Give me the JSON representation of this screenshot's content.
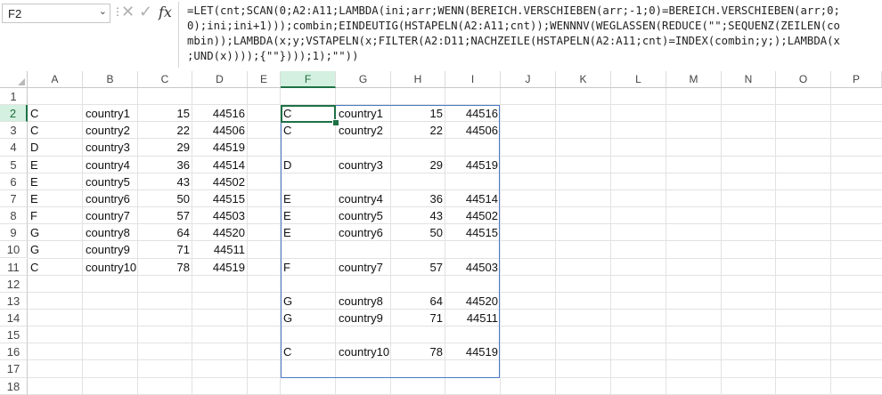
{
  "formula_bar": {
    "name_box": "F2",
    "fx_label": "fx",
    "formula_lines": [
      "=LET(cnt;SCAN(0;A2:A11;LAMBDA(ini;arr;WENN(BEREICH.VERSCHIEBEN(arr;-1;0)=BEREICH.VERSCHIEBEN(arr;0;",
      "0);ini;ini+1)));combin;EINDEUTIG(HSTAPELN(A2:A11;cnt));WENNNV(WEGLASSEN(REDUCE(\"\";SEQUENZ(ZEILEN(co",
      "mbin));LAMBDA(x;y;VSTAPELN(x;FILTER(A2:D11;NACHZEILE(HSTAPELN(A2:A11;cnt)=INDEX(combin;y;);LAMBDA(x",
      ";UND(x))));{\"\"})));1);\"\"))"
    ]
  },
  "columns": [
    "A",
    "B",
    "C",
    "D",
    "E",
    "F",
    "G",
    "H",
    "I",
    "J",
    "K",
    "L",
    "M",
    "N",
    "O",
    "P"
  ],
  "active_column": "F",
  "rows": [
    "1",
    "2",
    "3",
    "4",
    "5",
    "6",
    "7",
    "8",
    "9",
    "10",
    "11",
    "12",
    "13",
    "14",
    "15",
    "16",
    "17",
    "18"
  ],
  "active_row": "2",
  "source_table": [
    [
      "C",
      "country1",
      "15",
      "44516"
    ],
    [
      "C",
      "country2",
      "22",
      "44506"
    ],
    [
      "D",
      "country3",
      "29",
      "44519"
    ],
    [
      "E",
      "country4",
      "36",
      "44514"
    ],
    [
      "E",
      "country5",
      "43",
      "44502"
    ],
    [
      "E",
      "country6",
      "50",
      "44515"
    ],
    [
      "F",
      "country7",
      "57",
      "44503"
    ],
    [
      "G",
      "country8",
      "64",
      "44520"
    ],
    [
      "G",
      "country9",
      "71",
      "44511"
    ],
    [
      "C",
      "country10",
      "78",
      "44519"
    ]
  ],
  "result_rows": [
    [
      "C",
      "country1",
      "15",
      "44516"
    ],
    [
      "C",
      "country2",
      "22",
      "44506"
    ],
    [
      "",
      "",
      "",
      ""
    ],
    [
      "D",
      "country3",
      "29",
      "44519"
    ],
    [
      "",
      "",
      "",
      ""
    ],
    [
      "E",
      "country4",
      "36",
      "44514"
    ],
    [
      "E",
      "country5",
      "43",
      "44502"
    ],
    [
      "E",
      "country6",
      "50",
      "44515"
    ],
    [
      "",
      "",
      "",
      ""
    ],
    [
      "F",
      "country7",
      "57",
      "44503"
    ],
    [
      "",
      "",
      "",
      ""
    ],
    [
      "G",
      "country8",
      "64",
      "44520"
    ],
    [
      "G",
      "country9",
      "71",
      "44511"
    ],
    [
      "",
      "",
      "",
      ""
    ],
    [
      "C",
      "country10",
      "78",
      "44519"
    ],
    [
      "",
      "",
      "",
      ""
    ]
  ],
  "colors": {
    "accent": "#1e7145",
    "spill_border": "#4a7ac8",
    "header_active_bg": "#d3f0e0"
  }
}
